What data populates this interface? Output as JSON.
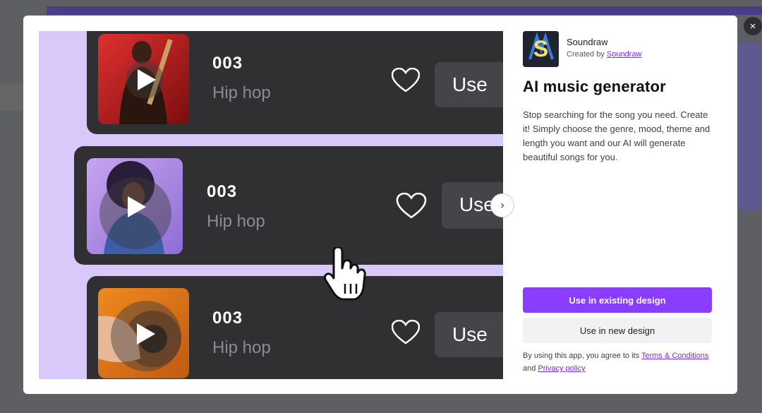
{
  "modal": {
    "app": {
      "name": "Soundraw",
      "created_by_prefix": "Created by",
      "created_by_link": "Soundraw",
      "icon": "soundraw-logo-icon"
    },
    "title": "AI music generator",
    "description": "Stop searching for the song you need. Create it! Simply choose the genre, mood, theme and length you want and our AI will generate beautiful songs for you.",
    "buttons": {
      "primary": "Use in existing design",
      "secondary": "Use in new design"
    },
    "terms": {
      "prefix": "By using this app, you agree to its",
      "terms_link": "Terms & Conditions",
      "and": "and",
      "privacy_link": "Privacy policy"
    },
    "close_icon": "×"
  },
  "preview": {
    "tracks": [
      {
        "number": "003",
        "genre": "Hip hop",
        "use_label": "Use"
      },
      {
        "number": "003",
        "genre": "Hip hop",
        "use_label": "Use"
      },
      {
        "number": "003",
        "genre": "Hip hop",
        "use_label": "Use"
      }
    ],
    "next_icon": "›"
  },
  "colors": {
    "accent": "#8b3dff",
    "preview_bg": "#d9c9fb",
    "card_bg": "#303033"
  }
}
